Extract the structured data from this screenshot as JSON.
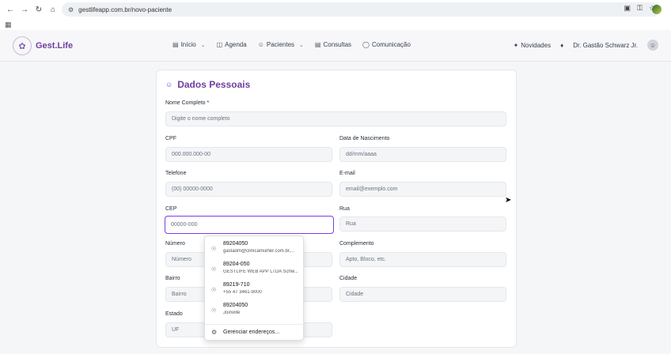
{
  "browser": {
    "url": "gestlifeapp.com.br/novo-paciente"
  },
  "app": {
    "logo": "Gest.Life",
    "menu": [
      {
        "label": "Início",
        "icon": "bar-chart-icon",
        "dropdown": true
      },
      {
        "label": "Agenda",
        "icon": "calendar-icon",
        "dropdown": false
      },
      {
        "label": "Pacientes",
        "icon": "users-icon",
        "dropdown": true
      },
      {
        "label": "Consultas",
        "icon": "clipboard-icon",
        "dropdown": false
      },
      {
        "label": "Comunicação",
        "icon": "chat-icon",
        "dropdown": false
      }
    ],
    "novidades": "Novidades",
    "user": "Dr. Gastão Schwarz Jr."
  },
  "form": {
    "title": "Dados Pessoais",
    "nome": {
      "label": "Nome Completo *",
      "placeholder": "Digite o nome completo"
    },
    "cpf": {
      "label": "CPF",
      "placeholder": "000.000.000-00"
    },
    "nascimento": {
      "label": "Data de Nascimento",
      "placeholder": "dd/mm/aaaa"
    },
    "telefone": {
      "label": "Telefone",
      "placeholder": "(00) 00000-0000"
    },
    "email": {
      "label": "E-mail",
      "placeholder": "email@exemplo.com"
    },
    "cep": {
      "label": "CEP",
      "placeholder": "00000-000"
    },
    "rua": {
      "label": "Rua",
      "placeholder": "Rua"
    },
    "numero": {
      "label": "Número",
      "placeholder": "Número"
    },
    "complemento": {
      "label": "Complemento",
      "placeholder": "Apto, Bloco, etc."
    },
    "bairro": {
      "label": "Bairro",
      "placeholder": "Bairro"
    },
    "cidade": {
      "label": "Cidade",
      "placeholder": "Cidade"
    },
    "estado": {
      "label": "Estado",
      "placeholder": "UF"
    }
  },
  "autocomplete": {
    "suggestions": [
      {
        "primary": "89204050",
        "secondary": "gastaom@clinicamulher.com.br,..."
      },
      {
        "primary": "89204-050",
        "secondary": "GESTLIFE WEB APP LTDA Schw..."
      },
      {
        "primary": "89219-710",
        "secondary": "+55 47 3461-9000"
      },
      {
        "primary": "89204050",
        "secondary": "Joinville"
      }
    ],
    "manage_label": "Gerenciar endereços..."
  }
}
